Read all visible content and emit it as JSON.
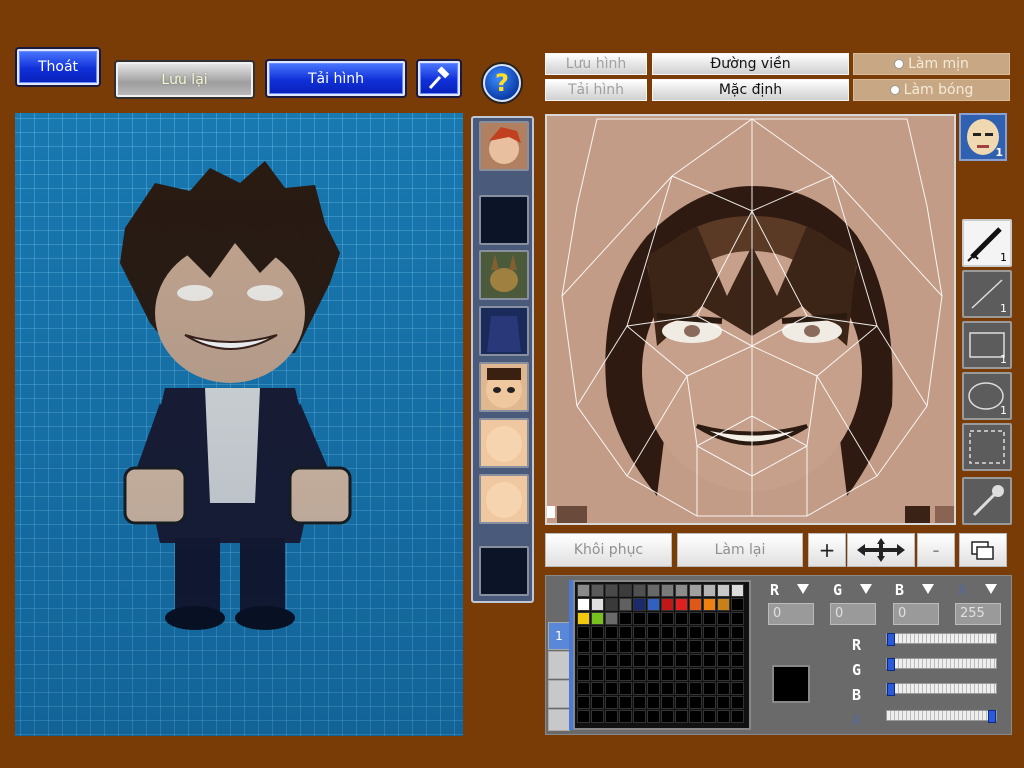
{
  "toolbar": {
    "exit_label": "Thoát",
    "save_label": "Lưu lại",
    "load_label": "Tải hình",
    "help_label": "?"
  },
  "editor_header": {
    "save_image": "Lưu hình",
    "load_image": "Tải hình",
    "outline": "Đường viền",
    "default": "Mặc định",
    "smooth": "Làm mịn",
    "shade": "Làm bóng"
  },
  "tools": {
    "pen_count": "1",
    "line_count": "1",
    "rect_count": "1",
    "ellipse_count": "1"
  },
  "face_thumb_badge": "1",
  "actions": {
    "restore": "Khôi phục",
    "redo": "Làm lại",
    "zoom_in": "+",
    "zoom_out": "-"
  },
  "palette": {
    "tab_1_label": "1",
    "row1": [
      "#8a8a8a",
      "#5a5a5a",
      "#4a4a4a",
      "#3c3c3c",
      "#505050",
      "#686868",
      "#7a7a7a",
      "#8c8c8c",
      "#a0a0a0",
      "#b4b4b4",
      "#c8c8c8",
      "#dcdcdc"
    ],
    "row2": [
      "#ffffff",
      "#e0e0e0",
      "#3a3a3a",
      "#606060",
      "#1a2a6a",
      "#3060c0",
      "#c01818",
      "#e02020",
      "#e05818",
      "#f08010",
      "#c88018"
    ],
    "row3": [
      "#f0c810",
      "#78c020",
      "#6a6a6a"
    ]
  },
  "color": {
    "labels": [
      "R",
      "G",
      "B",
      "A"
    ],
    "r": "0",
    "g": "0",
    "b": "0",
    "a": "255",
    "slider_r": 0,
    "slider_g": 0,
    "slider_b": 0,
    "slider_a": 1,
    "current": "#000000"
  }
}
